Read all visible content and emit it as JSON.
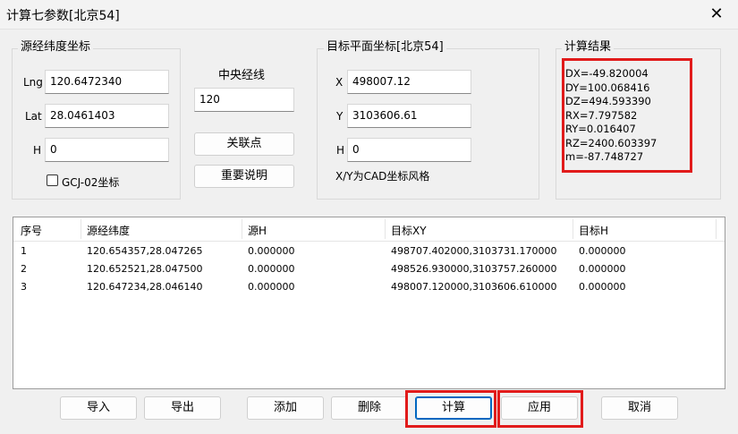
{
  "window": {
    "title": "计算七参数[北京54]",
    "close_glyph": "✕"
  },
  "source": {
    "group_label": "源经纬度坐标",
    "lng_label": "Lng",
    "lng_value": "120.6472340",
    "lat_label": "Lat",
    "lat_value": "28.0461403",
    "h_label": "H",
    "h_value": "0",
    "gcj_label": "GCJ-02坐标",
    "gcj_checked": false
  },
  "central": {
    "label": "中央经线",
    "value": "120",
    "relation_button": "关联点",
    "notes_button": "重要说明"
  },
  "target": {
    "group_label": "目标平面坐标[北京54]",
    "x_label": "X",
    "x_value": "498007.12",
    "y_label": "Y",
    "y_value": "3103606.61",
    "h_label": "H",
    "h_value": "0",
    "note": "X/Y为CAD坐标风格"
  },
  "result": {
    "group_label": "计算结果",
    "lines": [
      "DX=-49.820004",
      "DY=100.068416",
      "DZ=494.593390",
      "RX=7.797582",
      "RY=0.016407",
      "RZ=2400.603397",
      "m=-87.748727"
    ]
  },
  "table": {
    "headers": [
      "序号",
      "源经纬度",
      "源H",
      "目标XY",
      "目标H"
    ],
    "rows": [
      [
        "1",
        "120.654357,28.047265",
        "0.000000",
        "498707.402000,3103731.170000",
        "0.000000"
      ],
      [
        "2",
        "120.652521,28.047500",
        "0.000000",
        "498526.930000,3103757.260000",
        "0.000000"
      ],
      [
        "3",
        "120.647234,28.046140",
        "0.000000",
        "498007.120000,3103606.610000",
        "0.000000"
      ]
    ]
  },
  "buttons": {
    "import": "导入",
    "export": "导出",
    "add": "添加",
    "delete": "删除",
    "compute": "计算",
    "apply": "应用",
    "cancel": "取消"
  },
  "colors": {
    "highlight": "#e11b1b",
    "background": "#f0f0f0"
  }
}
